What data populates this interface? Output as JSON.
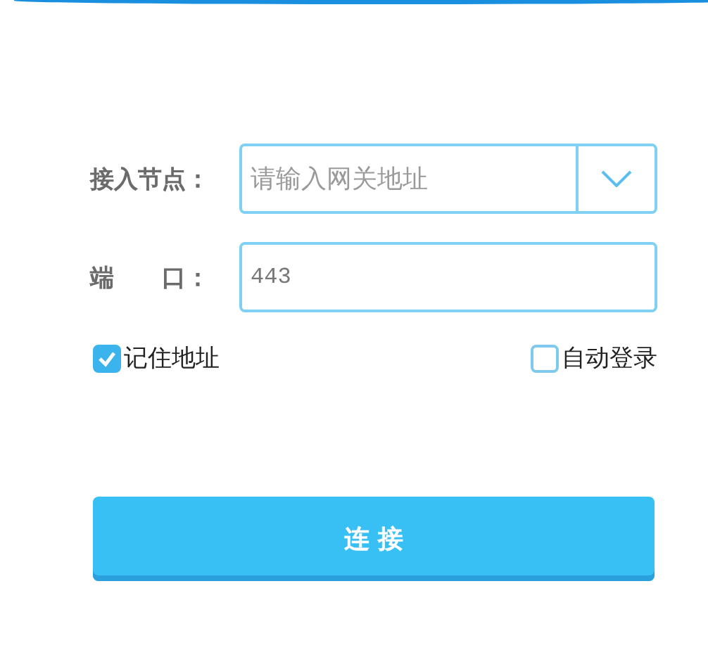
{
  "form": {
    "fields": [
      {
        "kind": "dropdown",
        "label": "接入节点：",
        "placeholder": "请输入网关地址"
      },
      {
        "kind": "text",
        "label": "端　　口：",
        "value": "443"
      }
    ],
    "options": [
      {
        "label": "记住地址",
        "checked": true
      },
      {
        "label": "自动登录",
        "checked": false
      }
    ],
    "submit": "连 接"
  }
}
